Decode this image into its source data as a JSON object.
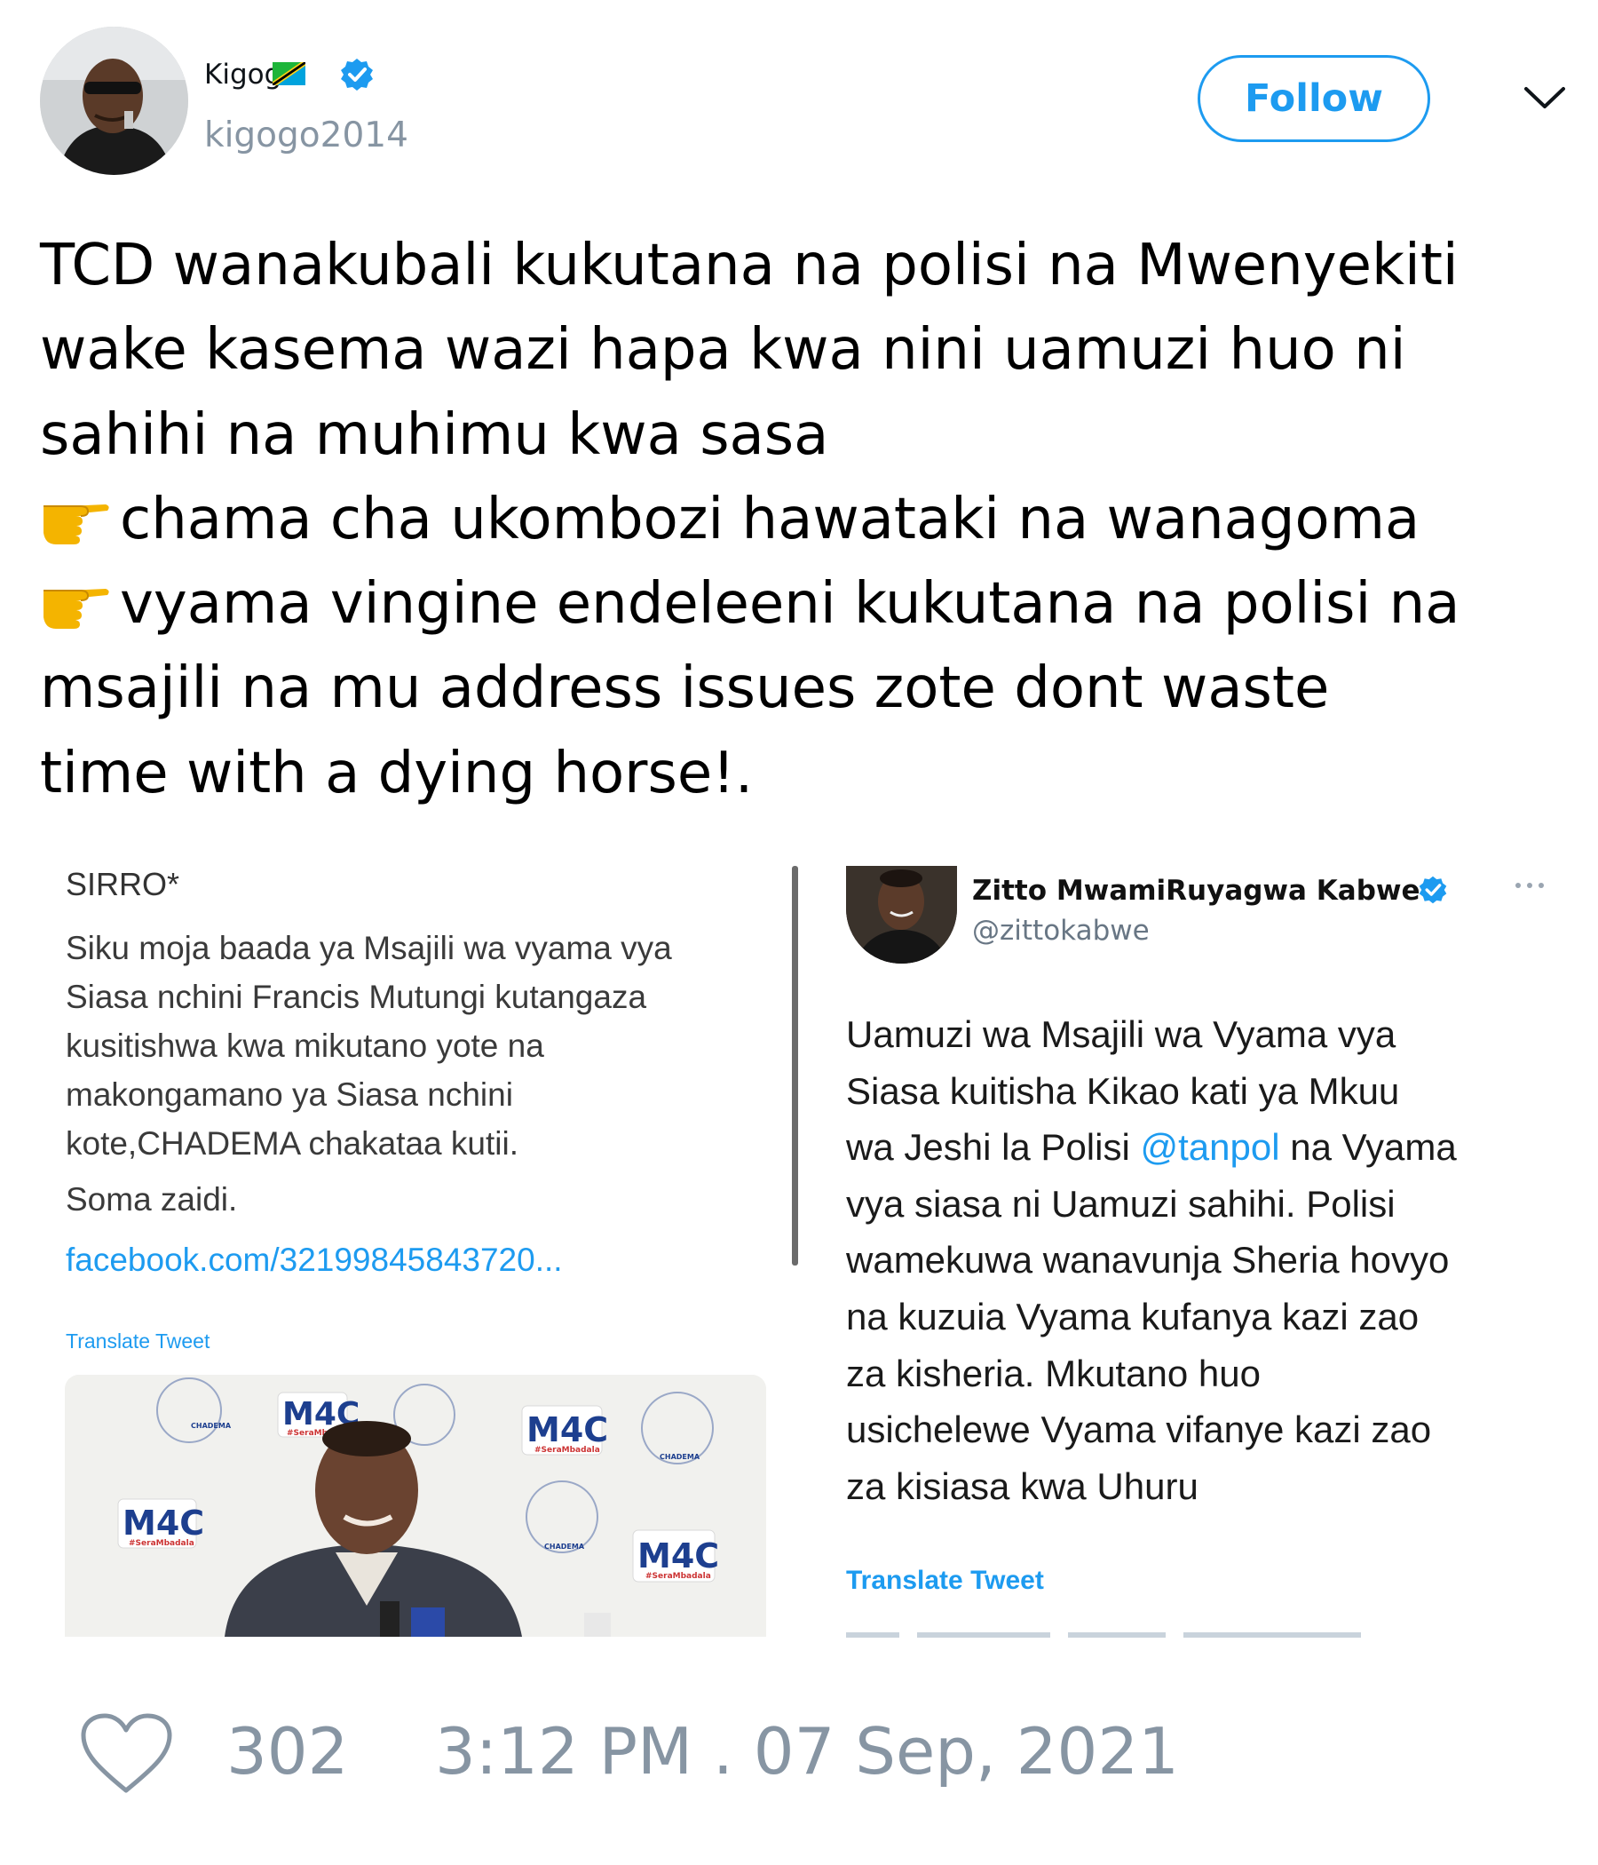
{
  "author": {
    "display_name": "Kigogo",
    "handle": "kigogo2014",
    "verified": true
  },
  "follow_label": "Follow",
  "tweet_lines": [
    "TCD wanakubali kukutana na polisi na Mwenyekiti",
    "wake kasema wazi hapa kwa nini uamuzi huo ni",
    "sahihi na muhimu kwa sasa",
    "chama cha ukombozi hawataki na wanagoma",
    "vyama vingine endeleeni kukutana na polisi na",
    "msajili na mu address issues zote dont waste",
    "time with a dying horse!."
  ],
  "left_pane": {
    "title": "SIRRO*",
    "body_lines": [
      "Siku moja baada ya Msajili wa vyama vya",
      "Siasa nchini Francis Mutungi kutangaza",
      "kusitishwa kwa mikutano yote na",
      "makongamano ya Siasa nchini",
      "kote,CHADEMA chakataa kutii."
    ],
    "more": "Soma zaidi.",
    "link": "facebook.com/32199845843720...",
    "translate": "Translate Tweet",
    "backdrop_logo": "M4C",
    "backdrop_tag": "#SeraMbadala",
    "backdrop_brand": "Chadema",
    "backdrop_stamp": "CHADEMA"
  },
  "right_pane": {
    "name": "Zitto MwamiRuyagwa Kabwe",
    "handle": "@zittokabwe",
    "body_lines": [
      {
        "pre": "Uamuzi wa Msajili wa Vyama vya",
        "mention": "",
        "post": ""
      },
      {
        "pre": "Siasa kuitisha Kikao kati ya Mkuu",
        "mention": "",
        "post": ""
      },
      {
        "pre": "wa Jeshi la Polisi ",
        "mention": "@tanpol",
        "post": " na Vyama"
      },
      {
        "pre": "vya siasa ni Uamuzi sahihi. Polisi",
        "mention": "",
        "post": ""
      },
      {
        "pre": "wamekuwa wanavunja Sheria hovyo",
        "mention": "",
        "post": ""
      },
      {
        "pre": "na kuzuia Vyama kufanya kazi zao",
        "mention": "",
        "post": ""
      },
      {
        "pre": "za kisheria. Mkutano huo",
        "mention": "",
        "post": ""
      },
      {
        "pre": "usichelewe Vyama vifanye kazi zao",
        "mention": "",
        "post": ""
      },
      {
        "pre": "za kisiasa kwa Uhuru",
        "mention": "",
        "post": ""
      }
    ],
    "translate": "Translate Tweet"
  },
  "footer": {
    "likes": "302",
    "timestamp": "3:12 PM . 07 Sep, 2021"
  },
  "colors": {
    "accent": "#1d9bf0",
    "muted": "#8795a3",
    "text": "#0f1419"
  },
  "icons": [
    "flag-tanzania-icon",
    "verified-badge-icon",
    "chevron-down-icon",
    "pointing-hand-icon",
    "more-icon",
    "heart-icon"
  ]
}
